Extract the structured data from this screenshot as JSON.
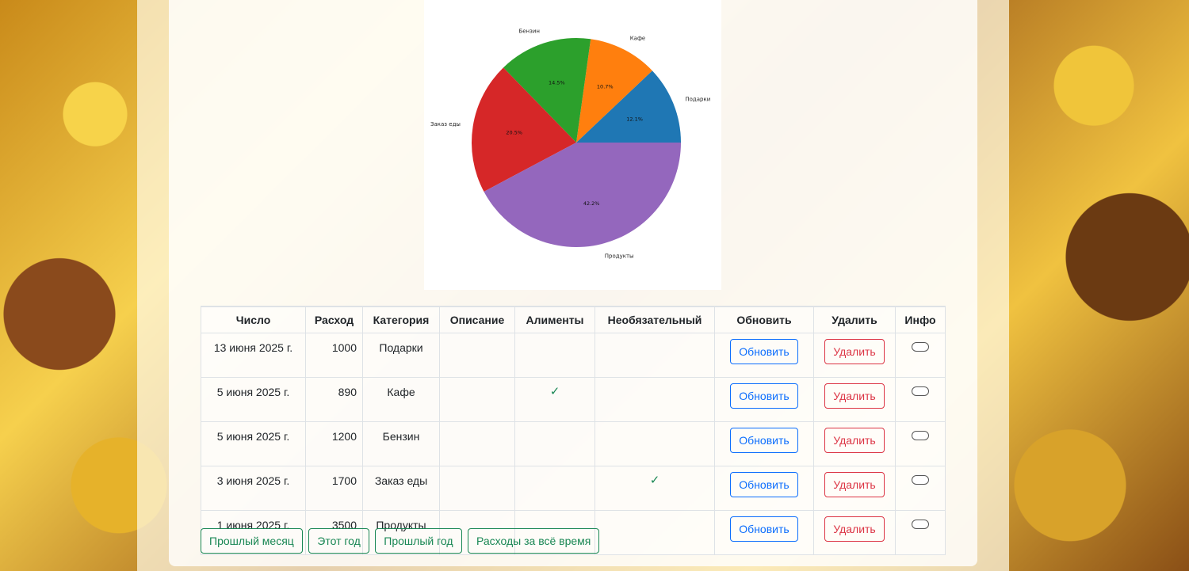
{
  "chart_data": {
    "type": "pie",
    "slices": [
      {
        "label": "Подарки",
        "value": 1000,
        "pct": "12.1%",
        "color": "#1f77b4"
      },
      {
        "label": "Кафе",
        "value": 890,
        "pct": "10.7%",
        "color": "#ff7f0e"
      },
      {
        "label": "Бензин",
        "value": 1200,
        "pct": "14.5%",
        "color": "#2ca02c"
      },
      {
        "label": "Заказ еды",
        "value": 1700,
        "pct": "20.5%",
        "color": "#d62728"
      },
      {
        "label": "Продукты",
        "value": 3500,
        "pct": "42.2%",
        "color": "#9467bd"
      }
    ]
  },
  "table": {
    "headers": [
      "Число",
      "Расход",
      "Категория",
      "Описание",
      "Алименты",
      "Необязательный",
      "Обновить",
      "Удалить",
      "Инфо"
    ],
    "rows": [
      {
        "date": "13 июня 2025 г.",
        "amount": "1000",
        "category": "Подарки",
        "description": "",
        "alimony": false,
        "optional": false
      },
      {
        "date": "5 июня 2025 г.",
        "amount": "890",
        "category": "Кафе",
        "description": "",
        "alimony": true,
        "optional": false
      },
      {
        "date": "5 июня 2025 г.",
        "amount": "1200",
        "category": "Бензин",
        "description": "",
        "alimony": false,
        "optional": false
      },
      {
        "date": "3 июня 2025 г.",
        "amount": "1700",
        "category": "Заказ еды",
        "description": "",
        "alimony": false,
        "optional": true
      },
      {
        "date": "1 июня 2025 г.",
        "amount": "3500",
        "category": "Продукты",
        "description": "",
        "alimony": false,
        "optional": false
      }
    ],
    "update_label": "Обновить",
    "delete_label": "Удалить",
    "check_glyph": "✓"
  },
  "period_buttons": [
    "Прошлый месяц",
    "Этот год",
    "Прошлый год",
    "Расходы за всё время"
  ]
}
